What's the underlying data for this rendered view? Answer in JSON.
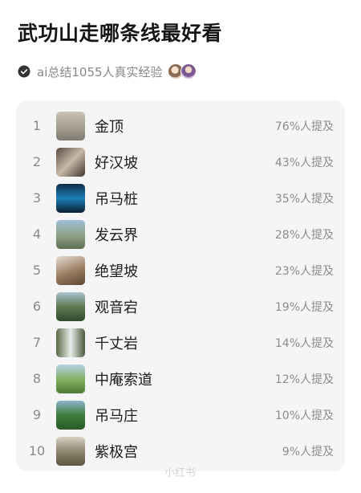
{
  "header": {
    "title": "武功山走哪条线最好看",
    "summary": "ai总结1055人真实经验"
  },
  "ranking": [
    {
      "rank": "1",
      "name": "金顶",
      "mention": "76%人提及",
      "thumb": "linear-gradient(180deg,#c9c3b8 0%,#a49d92 55%,#7f786e 100%)"
    },
    {
      "rank": "2",
      "name": "好汉坡",
      "mention": "43%人提及",
      "thumb": "linear-gradient(135deg,#5a4c44 0%,#c8b8a8 50%,#3e3530 100%)"
    },
    {
      "rank": "3",
      "name": "吊马桩",
      "mention": "35%人提及",
      "thumb": "linear-gradient(180deg,#0d2a48 0%,#1f7fb8 50%,#0b1e33 100%)"
    },
    {
      "rank": "4",
      "name": "发云界",
      "mention": "28%人提及",
      "thumb": "linear-gradient(180deg,#9fbfd6 0%,#8f9f86 55%,#5e6e52 100%)"
    },
    {
      "rank": "5",
      "name": "绝望坡",
      "mention": "23%人提及",
      "thumb": "linear-gradient(160deg,#e6ddd4 0%,#9a7c60 55%,#5b4634 100%)"
    },
    {
      "rank": "6",
      "name": "观音宕",
      "mention": "19%人提及",
      "thumb": "linear-gradient(180deg,#a9c2cf 0%,#5d7a52 50%,#2f4a2c 100%)"
    },
    {
      "rank": "7",
      "name": "千丈岩",
      "mention": "14%人提及",
      "thumb": "linear-gradient(90deg,#5a6a48 0%,#e9ece8 50%,#4b5a3c 100%)"
    },
    {
      "rank": "8",
      "name": "中庵索道",
      "mention": "12%人提及",
      "thumb": "linear-gradient(180deg,#b7d2e6 0%,#7fae5a 55%,#4d7a38 100%)"
    },
    {
      "rank": "9",
      "name": "吊马庄",
      "mention": "10%人提及",
      "thumb": "linear-gradient(180deg,#8fb2cc 0%,#3f7d3c 50%,#2a5a2a 100%)"
    },
    {
      "rank": "10",
      "name": "紫极宫",
      "mention": "9%人提及",
      "thumb": "linear-gradient(180deg,#d8d0c2 0%,#8f8770 50%,#5e5440 100%)"
    }
  ],
  "footer": {
    "watermark": "小红书"
  },
  "icons": {
    "check": "check-circle-icon"
  },
  "colors": {
    "card_bg": "#f5f5f6",
    "muted_text": "#888888"
  }
}
